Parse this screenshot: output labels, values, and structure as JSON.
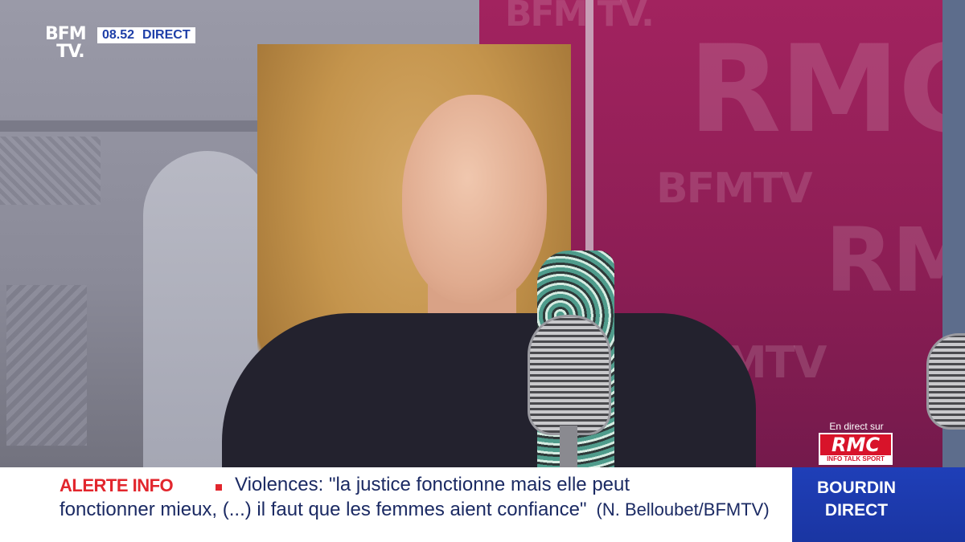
{
  "channel": {
    "logo_line1": "BFM",
    "logo_line2": "TV.",
    "time": "08.52",
    "live_label": "DIRECT"
  },
  "studio_backdrop": {
    "panel_logo_1": "BFM TV.",
    "panel_logo_2": "RMC",
    "panel_logo_3": "BFMTV",
    "panel_logo_4": "RMC",
    "panel_logo_5": "BFMTV"
  },
  "rmc_bug": {
    "caption": "En direct sur",
    "logo": "RMC",
    "tagline": "INFO TALK SPORT"
  },
  "lower_third": {
    "alert_label": "ALERTE INFO",
    "headline_line1": "Violences: \"la justice fonctionne mais elle peut",
    "headline_line2": "fonctionner mieux, (...) il faut que les femmes aient confiance\"",
    "credit": "(N. Belloubet/BFMTV)",
    "show_line1": "BOURDIN",
    "show_line2": "DIRECT"
  },
  "colors": {
    "alert_red": "#e2262d",
    "headline_navy": "#1b2a63",
    "show_blue": "#1f3fb8",
    "backdrop_magenta": "#a2235f"
  }
}
